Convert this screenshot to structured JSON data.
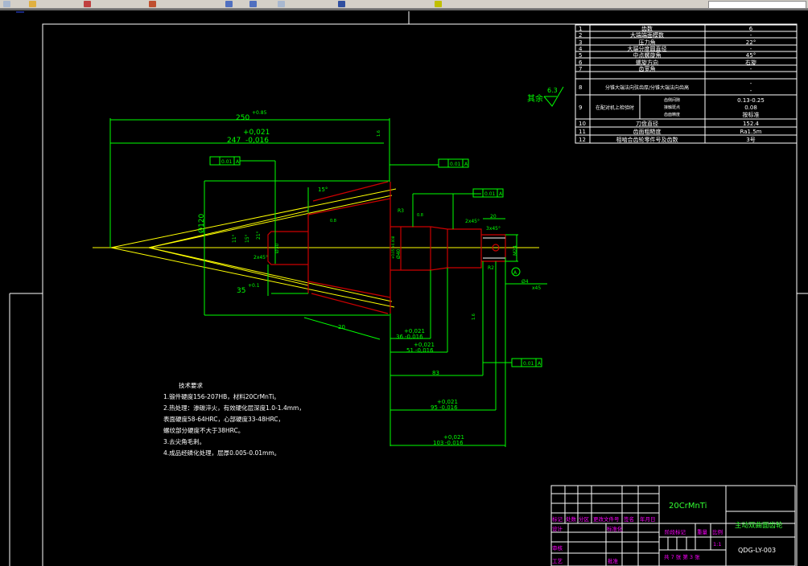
{
  "colors": {
    "background": "#000000",
    "frame": "#ffffff",
    "dimension": "#00ff00",
    "outline": "#cc0000",
    "centerline": "#ffff00",
    "title_text": "#ff00ff",
    "material_text": "#33ff33"
  },
  "toolbar": {
    "icons": [
      "save-icon",
      "open-icon",
      "undo-icon",
      "redo-icon",
      "layer-icon",
      "text-icon",
      "properties-icon",
      "print-icon",
      "zoom-icon"
    ]
  },
  "params_table": {
    "rows": [
      {
        "no": "1",
        "name": "齿数",
        "value": "6"
      },
      {
        "no": "2",
        "name": "大端端面模数",
        "value": "-"
      },
      {
        "no": "3",
        "name": "压力角",
        "value": "22°"
      },
      {
        "no": "4",
        "name": "大端分度圆直径",
        "value": "-"
      },
      {
        "no": "5",
        "name": "中点螺旋角",
        "value": "45°"
      },
      {
        "no": "6",
        "name": "螺旋方向",
        "value": "右旋"
      },
      {
        "no": "7",
        "name": "齿宽角",
        "value": "-"
      },
      {
        "no": "8",
        "name": "分锥大端法向弦齿厚/分锥大端法向齿高",
        "value": "-",
        "value2": "-"
      },
      {
        "no": "9",
        "name": "在配对机上检验时",
        "sub": [
          "齿侧间隙",
          "接触斑点",
          "齿面精度"
        ],
        "values": [
          "0.13-0.25",
          "0.08",
          "按标准"
        ]
      },
      {
        "no": "10",
        "name": "刀盘直径",
        "value": "152.4"
      },
      {
        "no": "11",
        "name": "齿面粗糙度",
        "value": "Ra1.5m"
      },
      {
        "no": "12",
        "name": "相啮合齿轮零件号及齿数",
        "value": "3号"
      }
    ]
  },
  "roughness_note": {
    "label": "其余",
    "value": "6.3"
  },
  "dimensions": {
    "overall": "250",
    "overall_tol": "+0.85",
    "d247": "247",
    "d247_tol_up": "+0,021",
    "d247_tol_low": "-0,016",
    "dia120": "Ø120",
    "dia30": "Ø30",
    "chamfer1": "2x45°",
    "d35": "35",
    "d35_tol": "+0.1",
    "d20": "20",
    "angle15": "15°",
    "angles": [
      "11°",
      "15°",
      "21°"
    ],
    "roughness_08a": "0.8",
    "roughness_08b": "0.8",
    "roughness_16a": "1.6",
    "roughness_16b": "1.6",
    "r3": "R3",
    "dia40": "Ø40",
    "dia40_tol": "+0.05 +0.008",
    "chamfer2": "2x45°",
    "chamfer3": "3x45°",
    "d20b": "20",
    "m24": "M24",
    "datum": "A",
    "r2": "R2",
    "hole": "Ø4",
    "hole_depth": "x45",
    "d36": "36",
    "d36_up": "+0,021",
    "d36_low": "-0,016",
    "d51": "51",
    "d51_up": "+0,021",
    "d51_low": "-0,016",
    "d83": "83",
    "d95": "95",
    "d95_up": "+0,021",
    "d95_low": "-0,016",
    "d103": "103",
    "d103_up": "+0,021",
    "d103_low": "-0,016",
    "runout_values": [
      "0.01",
      "0.01",
      "0.01",
      "0.01"
    ]
  },
  "tech_req": {
    "title": "技术要求",
    "lines": [
      "1.锻件硬度156-207HB，材料20CrMnTi。",
      "2.热处理：渗碳淬火，有效硬化层深度1.0-1.4mm，",
      "表面硬度58-64HRC，心部硬度33-48HRC，",
      "螺纹部分硬度不大于38HRC。",
      "3.去尖角毛刺。",
      "4.成品经磷化处理，层厚0.005-0.01mm。"
    ]
  },
  "title_block": {
    "headers": [
      "标记",
      "处数",
      "分区",
      "更改文件号",
      "签名",
      "年月日"
    ],
    "design": "设计",
    "standardize": "标准化",
    "review": "审核",
    "process": "工艺",
    "approve": "批准",
    "stage": "阶段标记",
    "weight": "重量",
    "scale_label": "比例",
    "scale": "1:1",
    "sheets": "共 7 张 第 3 张",
    "material": "20CrMnTi",
    "part_name": "主动双曲面齿轮",
    "drawing_no": "QDG-LY-003"
  }
}
